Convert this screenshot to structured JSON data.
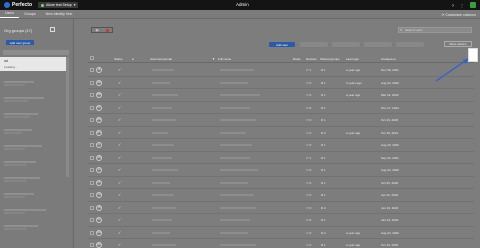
{
  "topbar": {
    "logo_text": "Perfecto",
    "env_selector": "Allure test Setup",
    "env_secondary": "",
    "title": "Admin",
    "help": "?",
    "menu": "⋮",
    "user_avatar": ""
  },
  "tabs": [
    {
      "label": "Users"
    },
    {
      "label": "Groups"
    },
    {
      "label": "New Identity Hub"
    }
  ],
  "subbar_right": "Customize columns",
  "left_panel": {
    "title": "Org groups (17)",
    "add_button": "Add user group",
    "selected_group": {
      "name": "ad",
      "count": "Loading..."
    }
  },
  "toolbar": {
    "toggle_left": "",
    "toggle_right": "",
    "search_placeholder": "Search users",
    "add_button": "Add user",
    "more_actions": "More actions"
  },
  "table": {
    "headers": {
      "status": "Status",
      "user": "Username/email",
      "full_name": "Full name",
      "roles": "Roles",
      "last_login": "Last login",
      "created_on": "Created on",
      "devices": "Devices",
      "shared": "Shared groups"
    },
    "rows": [
      {
        "initials": "JB",
        "devices": "1",
        "groups": "1",
        "last_login": "a year ago",
        "created": "Nov 30, 2021"
      },
      {
        "initials": "DR",
        "devices": "0",
        "groups": "1",
        "last_login": "3 years ago",
        "created": "Aug 24, 2020"
      },
      {
        "initials": "BM",
        "devices": "0",
        "groups": "1",
        "last_login": "a year ago",
        "created": "Mar 19, 2022"
      },
      {
        "initials": "ST",
        "devices": "0",
        "groups": "1",
        "last_login": "",
        "created": "Nov 17, 2024"
      },
      {
        "initials": "MR",
        "devices": "0",
        "groups": "1",
        "last_login": "",
        "created": "Oct 19, 2020"
      },
      {
        "initials": "MS",
        "devices": "0",
        "groups": "2",
        "last_login": "a year ago",
        "created": "Oct 18, 2021"
      },
      {
        "initials": "LT",
        "devices": "0",
        "groups": "1",
        "last_login": "",
        "created": "Aug 20, 2020"
      },
      {
        "initials": "AB",
        "devices": "1",
        "groups": "1",
        "last_login": "",
        "created": "Sep 20, 2021"
      },
      {
        "initials": "JO",
        "devices": "0",
        "groups": "1",
        "last_login": "",
        "created": "Aug 24, 2020"
      },
      {
        "initials": "KC",
        "devices": "0",
        "groups": "1",
        "last_login": "",
        "created": "Oct 25, 2020"
      },
      {
        "initials": "TG",
        "devices": "0",
        "groups": "1",
        "last_login": "",
        "created": "Apr 22, 2022"
      },
      {
        "initials": "JB",
        "devices": "0",
        "groups": "2",
        "last_login": "",
        "created": "Jun 10, 2022"
      },
      {
        "initials": "SL",
        "devices": "0",
        "groups": "1",
        "last_login": "",
        "created": "Jan 23, 2020"
      },
      {
        "initials": "AW",
        "devices": "0",
        "groups": "2",
        "last_login": "a year ago",
        "created": "Aug 24, 2020"
      },
      {
        "initials": "MR",
        "devices": "0",
        "groups": "1",
        "last_login": "a year ago",
        "created": "Oct 19, 2020"
      }
    ]
  },
  "colors": {
    "primary": "#2a5aa8",
    "topbar": "#141414",
    "overlay": "#7d7d7d",
    "highlight": "#ffffff",
    "arrow": "#2f5fd0"
  }
}
